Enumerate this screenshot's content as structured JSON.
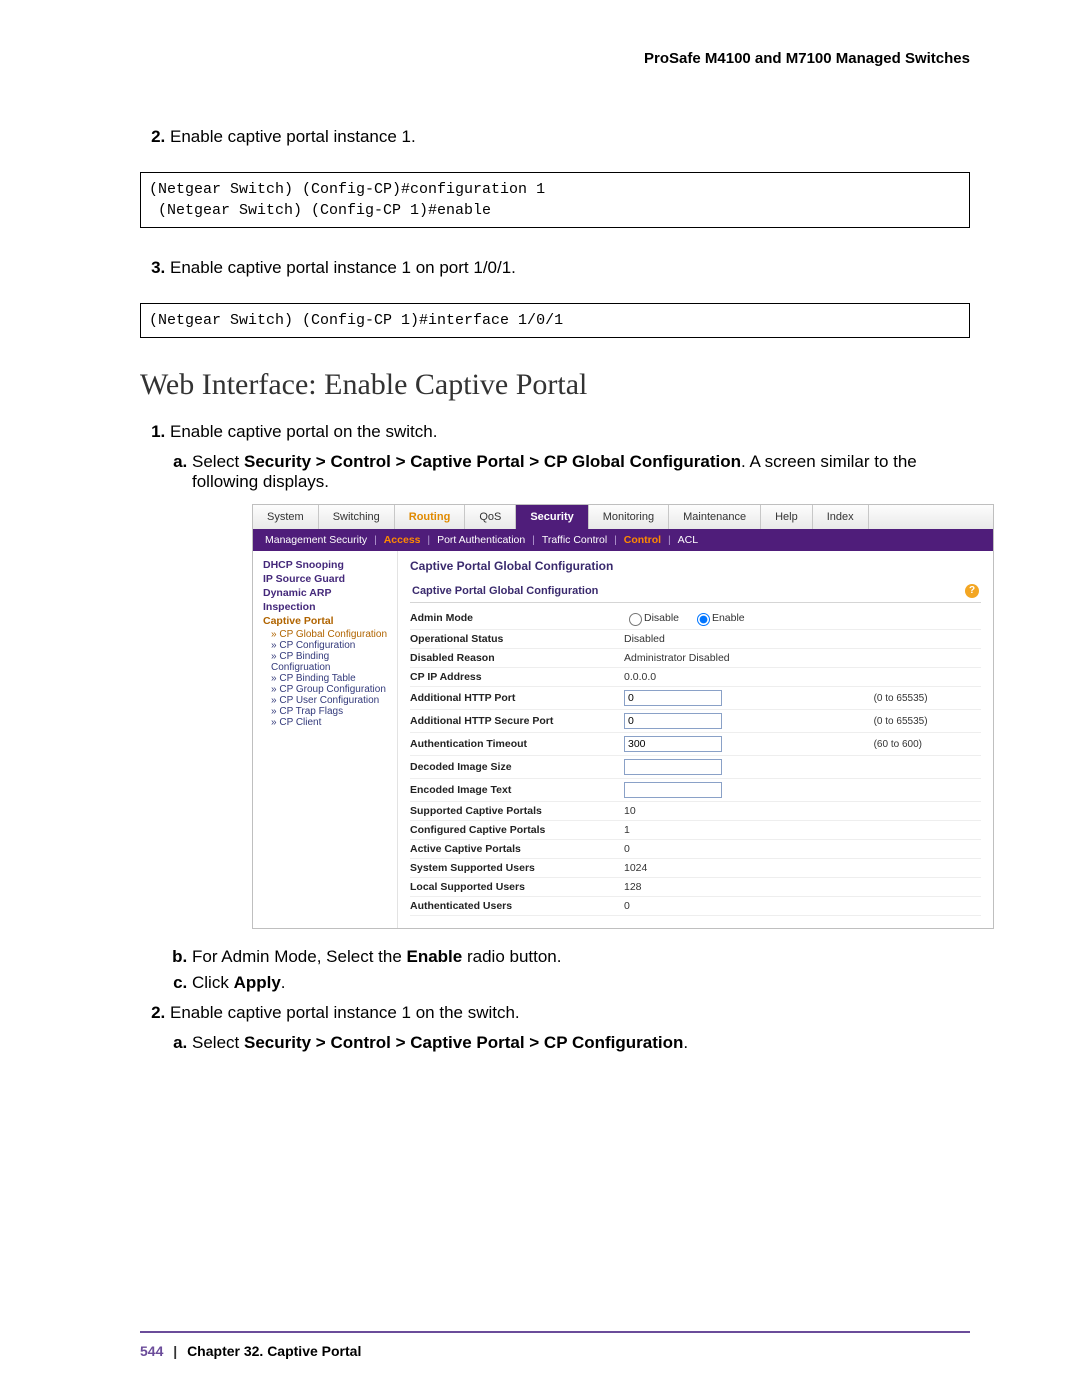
{
  "doc_header": "ProSafe M4100 and M7100 Managed Switches",
  "step2": "Enable captive portal instance 1.",
  "code1_line1": "(Netgear Switch) (Config-CP)#configuration 1",
  "code1_line2": " (Netgear Switch) (Config-CP 1)#enable",
  "step3": "Enable captive portal instance 1 on port 1/0/1.",
  "code2": "(Netgear Switch) (Config-CP 1)#interface 1/0/1",
  "section_title": "Web Interface: Enable Captive Portal",
  "w_step1": "Enable captive portal on the switch.",
  "w_step1a_pre": "Select ",
  "w_step1a_bold": "Security > Control > Captive Portal > CP Global Configuration",
  "w_step1a_post": ". A screen similar to the following displays.",
  "w_step1b_pre": "For Admin Mode, Select the ",
  "w_step1b_bold": "Enable",
  "w_step1b_post": " radio button.",
  "w_step1c_pre": "Click ",
  "w_step1c_bold": "Apply",
  "w_step1c_post": ".",
  "w_step2": "Enable captive portal instance 1 on the switch.",
  "w_step2a_pre": "Select ",
  "w_step2a_bold": "Security > Control > Captive Portal > CP Configuration",
  "w_step2a_post": ".",
  "tabs": {
    "system": "System",
    "switching": "Switching",
    "routing": "Routing",
    "qos": "QoS",
    "security": "Security",
    "monitoring": "Monitoring",
    "maintenance": "Maintenance",
    "help": "Help",
    "index": "Index"
  },
  "subnav": {
    "management": "Management Security",
    "access": "Access",
    "portauth": "Port Authentication",
    "traffic": "Traffic Control",
    "control": "Control",
    "acl": "ACL"
  },
  "sidebar": {
    "dhcp": "DHCP Snooping",
    "ipsource": "IP Source Guard",
    "dynarp": "Dynamic ARP",
    "inspection": "Inspection",
    "captive": "Captive Portal",
    "cp_global": "CP Global Configuration",
    "cp_config": "CP Configuration",
    "cp_bindc": "CP Binding Configruation",
    "cp_bindt": "CP Binding Table",
    "cp_group": "CP Group Configuration",
    "cp_user": "CP User Configuration",
    "cp_trap": "CP Trap Flags",
    "cp_client": "CP Client"
  },
  "panel_title": "Captive Portal Global Configuration",
  "panel_subtitle": "Captive Portal Global Configuration",
  "help_glyph": "?",
  "fields": {
    "admin_mode": "Admin Mode",
    "disable": "Disable",
    "enable": "Enable",
    "op_status_l": "Operational Status",
    "op_status_v": "Disabled",
    "dis_reason_l": "Disabled Reason",
    "dis_reason_v": "Administrator Disabled",
    "cp_ip_l": "CP IP Address",
    "cp_ip_v": "0.0.0.0",
    "http_l": "Additional HTTP Port",
    "http_v": "0",
    "http_hint": "(0 to 65535)",
    "https_l": "Additional HTTP Secure Port",
    "https_v": "0",
    "https_hint": "(0 to 65535)",
    "auth_to_l": "Authentication Timeout",
    "auth_to_v": "300",
    "auth_to_hint": "(60 to 600)",
    "dec_img_l": "Decoded Image Size",
    "enc_img_l": "Encoded Image Text",
    "sup_cp_l": "Supported Captive Portals",
    "sup_cp_v": "10",
    "cfg_cp_l": "Configured Captive Portals",
    "cfg_cp_v": "1",
    "act_cp_l": "Active Captive Portals",
    "act_cp_v": "0",
    "sys_u_l": "System Supported Users",
    "sys_u_v": "1024",
    "loc_u_l": "Local Supported Users",
    "loc_u_v": "128",
    "auth_u_l": "Authenticated Users",
    "auth_u_v": "0"
  },
  "footer": {
    "page": "544",
    "sep": "|",
    "chapter": "Chapter 32.  Captive Portal"
  }
}
